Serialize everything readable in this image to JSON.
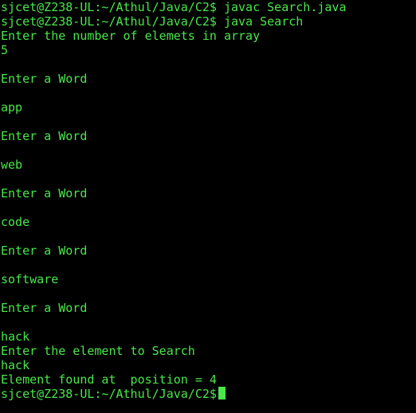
{
  "terminal": {
    "lines": [
      "sjcet@Z238-UL:~/Athul/Java/C2$ javac Search.java",
      "sjcet@Z238-UL:~/Athul/Java/C2$ java Search",
      "Enter the number of elemets in array",
      "5",
      "",
      "Enter a Word",
      "",
      "app",
      "",
      "Enter a Word",
      "",
      "web",
      "",
      "Enter a Word",
      "",
      "code",
      "",
      "Enter a Word",
      "",
      "software",
      "",
      "Enter a Word",
      "",
      "hack",
      "Enter the element to Search",
      "hack",
      "Element found at  position = 4",
      "sjcet@Z238-UL:~/Athul/Java/C2$"
    ],
    "colors": {
      "background": "#000000",
      "text": "#49e64a"
    }
  }
}
